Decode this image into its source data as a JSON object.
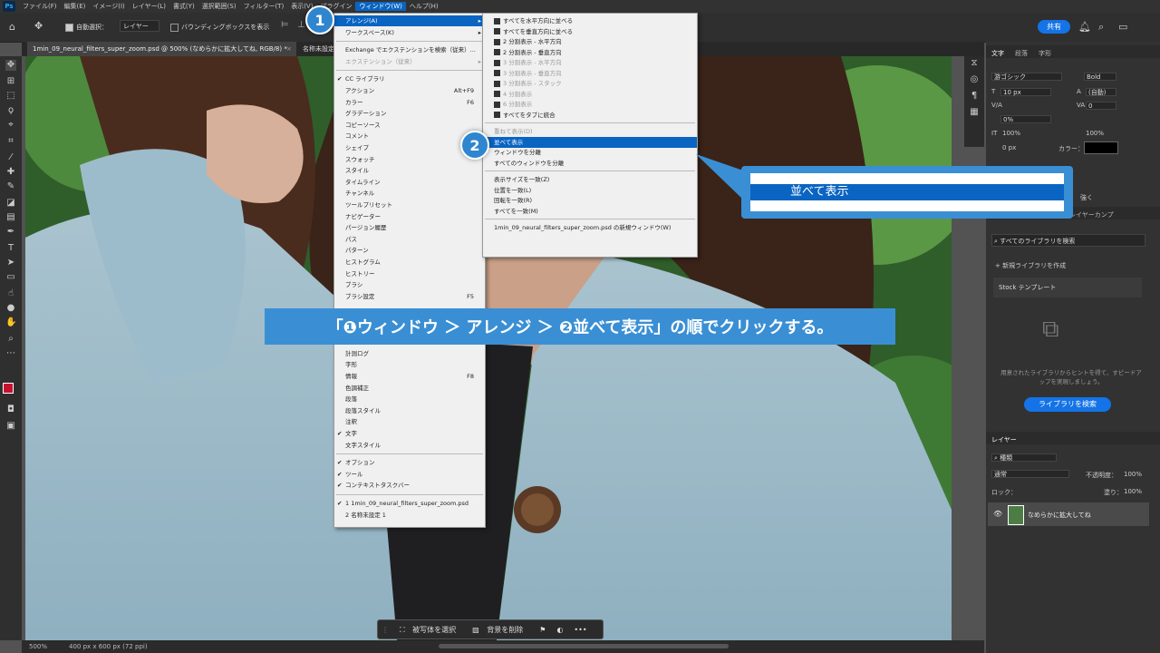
{
  "menubar": {
    "items": [
      "ファイル(F)",
      "編集(E)",
      "イメージ(I)",
      "レイヤー(L)",
      "書式(Y)",
      "選択範囲(S)",
      "フィルター(T)",
      "表示(V)",
      "プラグイン",
      "ウィンドウ(W)",
      "ヘルプ(H)"
    ],
    "active_index": 9
  },
  "options": {
    "auto_select_label": "自動選択：",
    "layer_select": "レイヤー",
    "bounding_box_label": "バウンディングボックスを表示",
    "share_button": "共有"
  },
  "tabs": [
    {
      "label": "1min_09_neural_filters_super_zoom.psd @ 500% (なめらかに拡大してね, RGB/8) *",
      "active": true
    },
    {
      "label": "名称未設定"
    }
  ],
  "window_menu": {
    "items": [
      {
        "label": "アレンジ(A)",
        "arrow": true,
        "highlight": true
      },
      {
        "label": "ワークスペース(K)",
        "arrow": true
      },
      {
        "sep": true
      },
      {
        "label": "Exchange でエクステンションを検索（従来）..."
      },
      {
        "label": "エクステンション（従来）",
        "arrow": true,
        "disabled": true
      },
      {
        "sep": true
      },
      {
        "label": "CC ライブラリ",
        "check": true
      },
      {
        "label": "アクション",
        "shortcut": "Alt+F9"
      },
      {
        "label": "カラー",
        "shortcut": "F6"
      },
      {
        "label": "グラデーション"
      },
      {
        "label": "コピーソース"
      },
      {
        "label": "コメント"
      },
      {
        "label": "シェイプ"
      },
      {
        "label": "スウォッチ"
      },
      {
        "label": "スタイル"
      },
      {
        "label": "タイムライン"
      },
      {
        "label": "チャンネル"
      },
      {
        "label": "ツールプリセット"
      },
      {
        "label": "ナビゲーター"
      },
      {
        "label": "パージョン履歴"
      },
      {
        "label": "パス"
      },
      {
        "label": "パターン"
      },
      {
        "label": "ヒストグラム"
      },
      {
        "label": "ヒストリー"
      },
      {
        "label": "ブラシ"
      },
      {
        "label": "ブラシ設定",
        "shortcut": "F5"
      },
      {
        "label": ""
      },
      {
        "label": ""
      },
      {
        "label": ""
      },
      {
        "label": ""
      },
      {
        "label": "計測ログ"
      },
      {
        "label": "字形"
      },
      {
        "label": "情報",
        "shortcut": "F8"
      },
      {
        "label": "色調補正"
      },
      {
        "label": "段落"
      },
      {
        "label": "段落スタイル"
      },
      {
        "label": "注釈"
      },
      {
        "label": "文字",
        "check": true
      },
      {
        "label": "文字スタイル"
      },
      {
        "sep": true
      },
      {
        "label": "オプション",
        "check": true
      },
      {
        "label": "ツール",
        "check": true
      },
      {
        "label": "コンテキストタスクバー",
        "check": true
      },
      {
        "sep": true
      },
      {
        "label": "1 1min_09_neural_filters_super_zoom.psd",
        "check": true
      },
      {
        "label": "2 名称未設定 1"
      }
    ]
  },
  "arrange_menu": {
    "items": [
      {
        "label": "すべてを水平方向に並べる",
        "icon": true
      },
      {
        "label": "すべてを垂直方向に並べる",
        "icon": true
      },
      {
        "label": "2 分割表示 - 水平方向",
        "icon": true
      },
      {
        "label": "2 分割表示 - 垂直方向",
        "icon": true
      },
      {
        "label": "3 分割表示 - 水平方向",
        "icon": true,
        "disabled": true
      },
      {
        "label": "3 分割表示 - 垂直方向",
        "icon": true,
        "disabled": true
      },
      {
        "label": "3 分割表示 - スタック",
        "icon": true,
        "disabled": true
      },
      {
        "label": "4 分割表示",
        "icon": true,
        "disabled": true
      },
      {
        "label": "6 分割表示",
        "icon": true,
        "disabled": true
      },
      {
        "label": "すべてをタブに統合",
        "icon": true
      },
      {
        "sep": true
      },
      {
        "label": "重ねて表示(D)",
        "disabled": true
      },
      {
        "label": "並べて表示",
        "highlight": true
      },
      {
        "label": "ウィンドウを分離"
      },
      {
        "label": "すべてのウィンドウを分離"
      },
      {
        "sep": true
      },
      {
        "label": "表示サイズを一致(Z)"
      },
      {
        "label": "位置を一致(L)"
      },
      {
        "label": "回転を一致(R)"
      },
      {
        "label": "すべてを一致(M)"
      },
      {
        "sep": true
      },
      {
        "label": "1min_09_neural_filters_super_zoom.psd の新規ウィンドウ(W)"
      }
    ]
  },
  "callouts": {
    "badge1": "1",
    "badge2": "2",
    "zoom_label": "並べて表示",
    "banner": "「❶ウィンドウ ＞ アレンジ ＞ ❷並べて表示」の順でクリックする。"
  },
  "context_bar": {
    "select_subject": "被写体を選択",
    "remove_bg": "背景を削除",
    "more": "•••"
  },
  "status": {
    "zoom": "500%",
    "doc_size": "400 px x 600 px (72 ppi)"
  },
  "right_panel": {
    "tabs": [
      "文字",
      "段落",
      "字形"
    ],
    "font_family": "游ゴシック",
    "font_style": "Bold",
    "font_size": "10 px",
    "leading": "(自動)",
    "kerning": "0",
    "tracking": "0%",
    "vscale": "100%",
    "hscale": "100%",
    "baseline": "0 px",
    "color_label": "カラー：",
    "aa": "強く",
    "lib_tab": "レイヤーカンプ",
    "lib_search": "すべてのライブラリを検索",
    "new_lib": "新規ライブラリを作成",
    "stock": "Stock テンプレート",
    "lib_hint": "用意されたライブラリからヒントを得て、すピードアップを実現しましょう。",
    "lib_button": "ライブラリを検索",
    "layers_tab": "レイヤー",
    "kind": "種類",
    "blend": "通常",
    "opacity_label": "不透明度：",
    "opacity": "100%",
    "lock_label": "ロック：",
    "fill_label": "塗り：",
    "fill": "100%",
    "layer_name": "なめらかに拡大してね"
  }
}
